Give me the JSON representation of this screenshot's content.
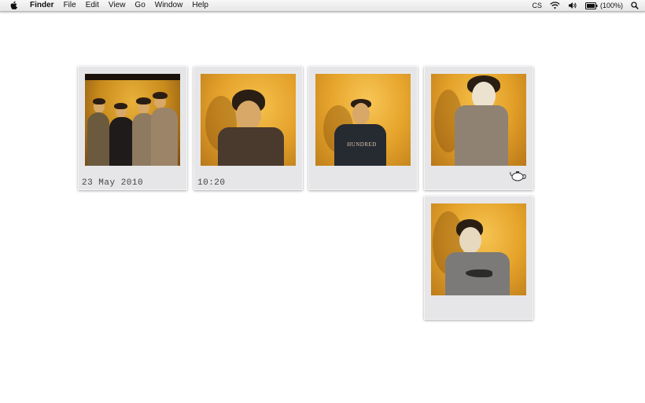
{
  "menubar": {
    "app_name": "Finder",
    "items": [
      "File",
      "Edit",
      "View",
      "Go",
      "Window",
      "Help"
    ],
    "status": {
      "cs_label": "CS",
      "battery_label": "(100%)"
    }
  },
  "desktop": {
    "polaroids": [
      {
        "caption": "23 May 2010"
      },
      {
        "caption": "10:20"
      },
      {
        "caption": ""
      },
      {
        "caption": ""
      },
      {
        "caption": ""
      }
    ]
  },
  "sweater_text": "HUNDRED",
  "colors": {
    "photo_yellow": "#e9a323",
    "frame": "#e6e6e8"
  }
}
